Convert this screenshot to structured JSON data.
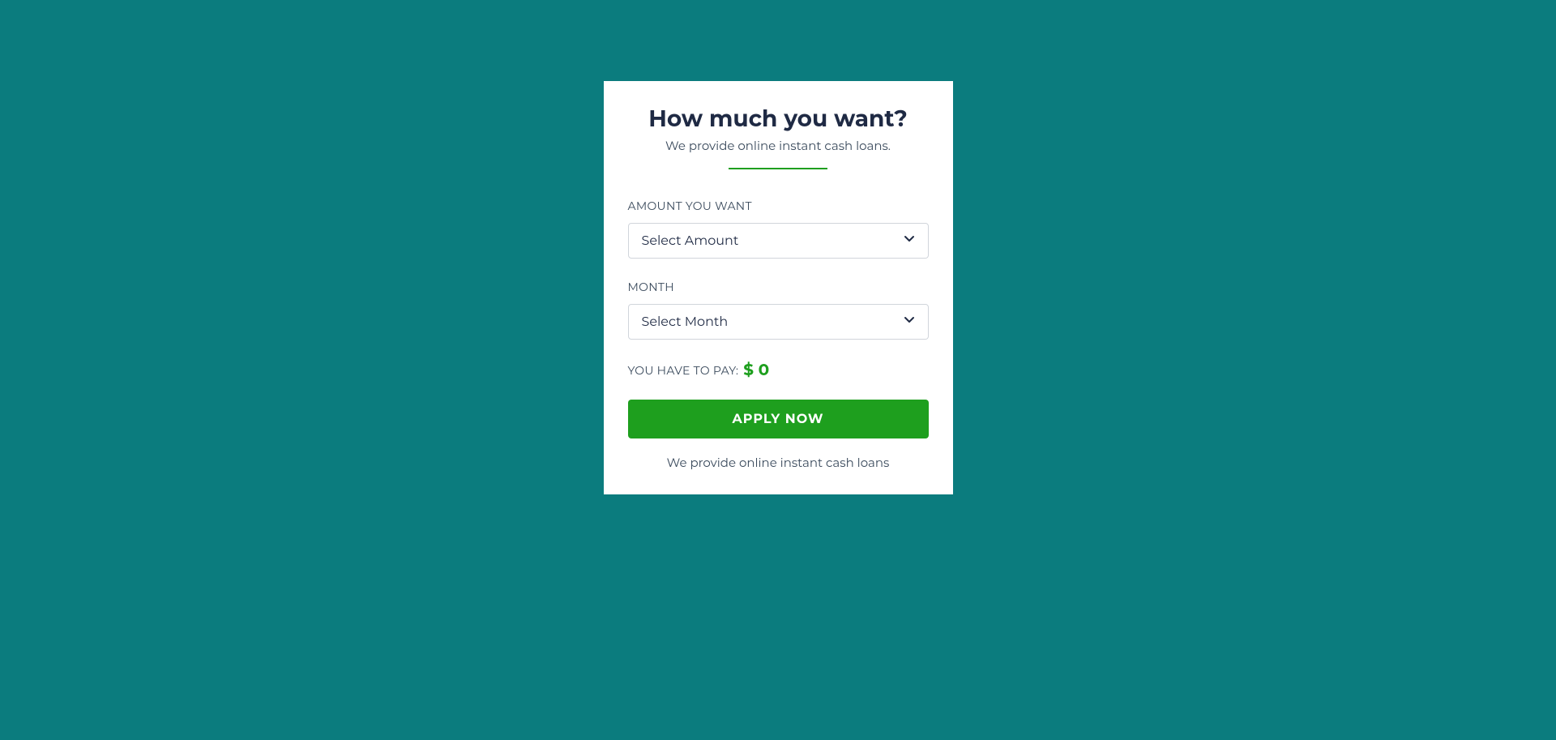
{
  "card": {
    "title": "How much you want?",
    "subtitle": "We provide online instant cash loans.",
    "amount_label": "AMOUNT YOU WANT",
    "amount_selected": "Select Amount",
    "month_label": "MONTH",
    "month_selected": "Select Month",
    "pay_label": "YOU HAVE TO PAY:",
    "pay_value": "$ 0",
    "apply_button": "APPLY NOW",
    "footer": "We provide online instant cash loans"
  }
}
